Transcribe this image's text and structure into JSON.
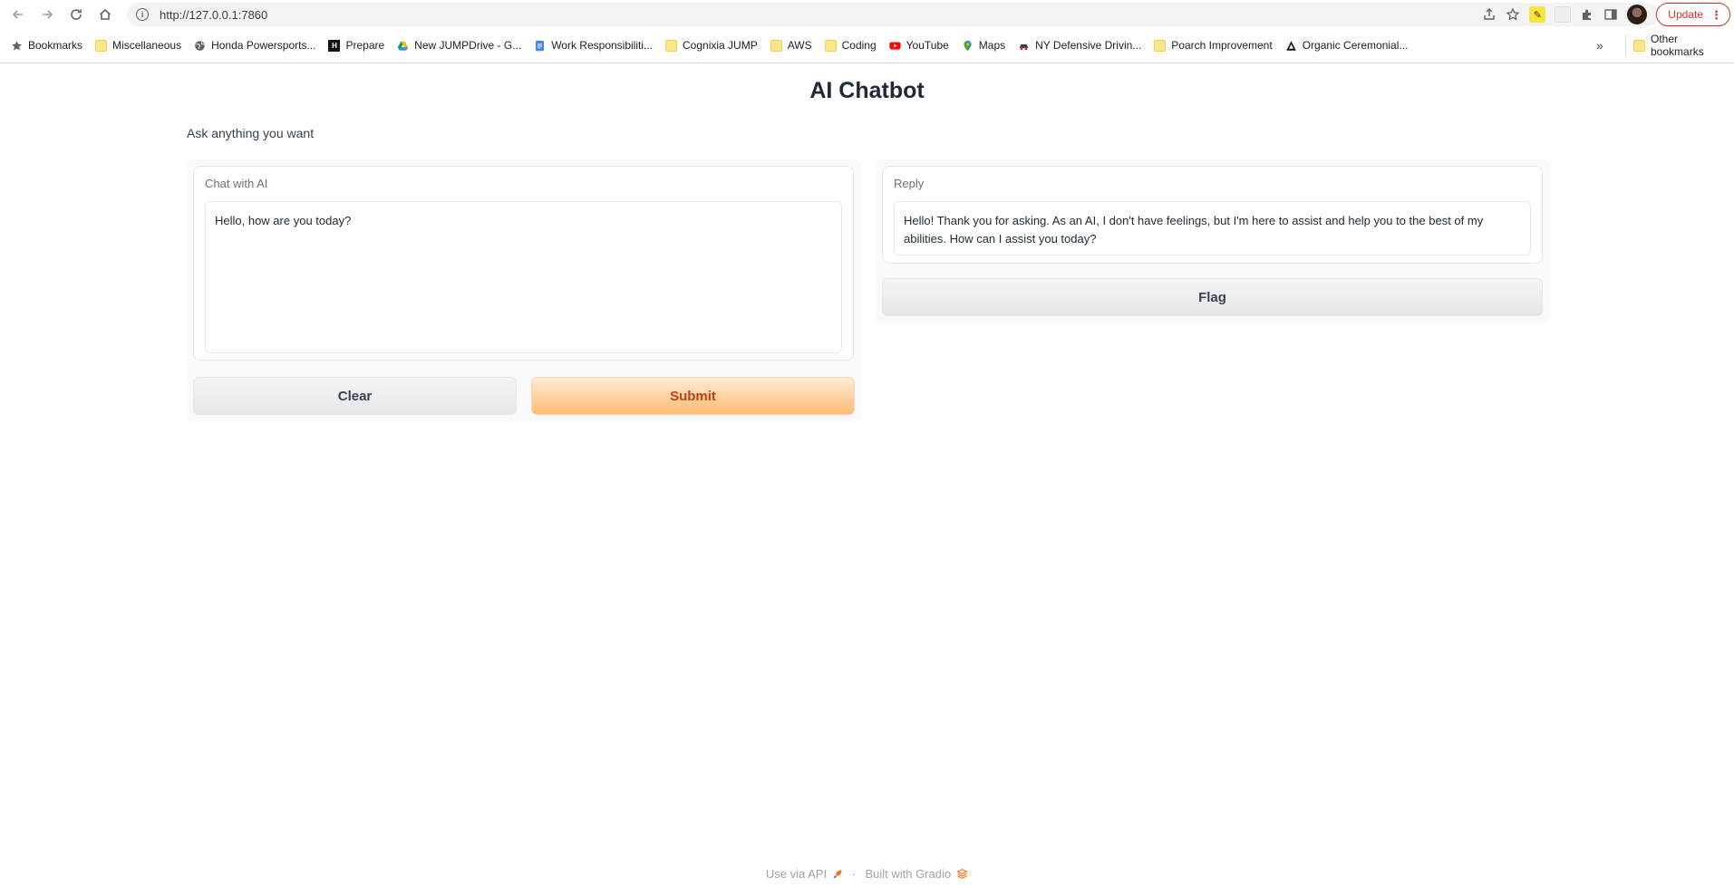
{
  "browser": {
    "url": "http://127.0.0.1:7860",
    "update_label": "Update"
  },
  "bookmarks": [
    {
      "label": "Bookmarks",
      "icon": "star-icon"
    },
    {
      "label": "Miscellaneous",
      "icon": "folder-icon"
    },
    {
      "label": "Honda Powersports...",
      "icon": "globe-icon"
    },
    {
      "label": "Prepare",
      "icon": "hackerrank-icon"
    },
    {
      "label": "New JUMPDrive - G...",
      "icon": "google-drive-icon"
    },
    {
      "label": "Work Responsibiliti...",
      "icon": "google-docs-icon"
    },
    {
      "label": "Cognixia JUMP",
      "icon": "folder-icon"
    },
    {
      "label": "AWS",
      "icon": "folder-icon"
    },
    {
      "label": "Coding",
      "icon": "folder-icon"
    },
    {
      "label": "YouTube",
      "icon": "youtube-icon"
    },
    {
      "label": "Maps",
      "icon": "maps-icon"
    },
    {
      "label": "NY Defensive Drivin...",
      "icon": "car-icon"
    },
    {
      "label": "Poarch Improvement",
      "icon": "folder-icon"
    },
    {
      "label": "Organic Ceremonial...",
      "icon": "triangle-logo-icon"
    }
  ],
  "bookmarks_more": "»",
  "other_bookmarks": "Other bookmarks",
  "app": {
    "title": "AI Chatbot",
    "description": "Ask anything you want"
  },
  "input": {
    "label": "Chat with AI",
    "value": "Hello, how are you today?"
  },
  "output": {
    "label": "Reply",
    "value": "Hello! Thank you for asking. As an AI, I don't have feelings, but I'm here to assist and help you to the best of my abilities. How can I assist you today?"
  },
  "buttons": {
    "clear": "Clear",
    "submit": "Submit",
    "flag": "Flag"
  },
  "footer": {
    "api_link": "Use via API",
    "separator": "·",
    "built_with": "Built with Gradio"
  },
  "colors": {
    "primary_button": "#fdba74",
    "primary_text": "#c2410c",
    "gradio_orange": "#f97316"
  }
}
